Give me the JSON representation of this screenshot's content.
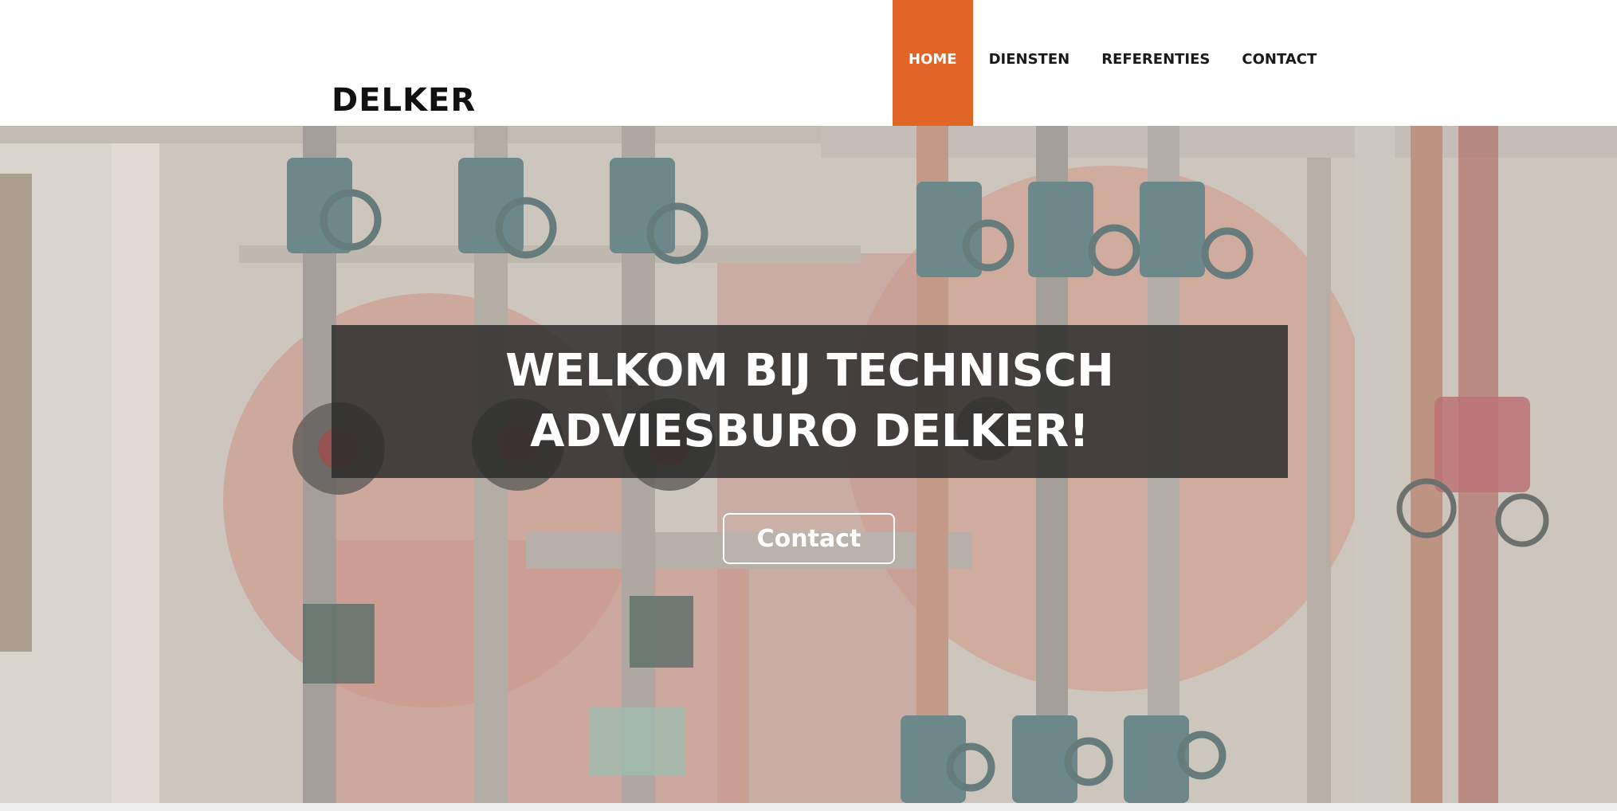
{
  "header": {
    "brand": "DELKER",
    "nav": [
      {
        "label": "HOME",
        "active": true
      },
      {
        "label": "DIENSTEN",
        "active": false
      },
      {
        "label": "REFERENTIES",
        "active": false
      },
      {
        "label": "CONTACT",
        "active": false
      }
    ]
  },
  "hero": {
    "title": "WELKOM BIJ TECHNISCH ADVIESBURO DELKER!",
    "cta_label": "Contact",
    "background_subject": "pipes-and-valves-photo"
  },
  "colors": {
    "accent": "#e16526",
    "title_box": "#2d2d2d",
    "text_dark": "#1a1a1a"
  }
}
